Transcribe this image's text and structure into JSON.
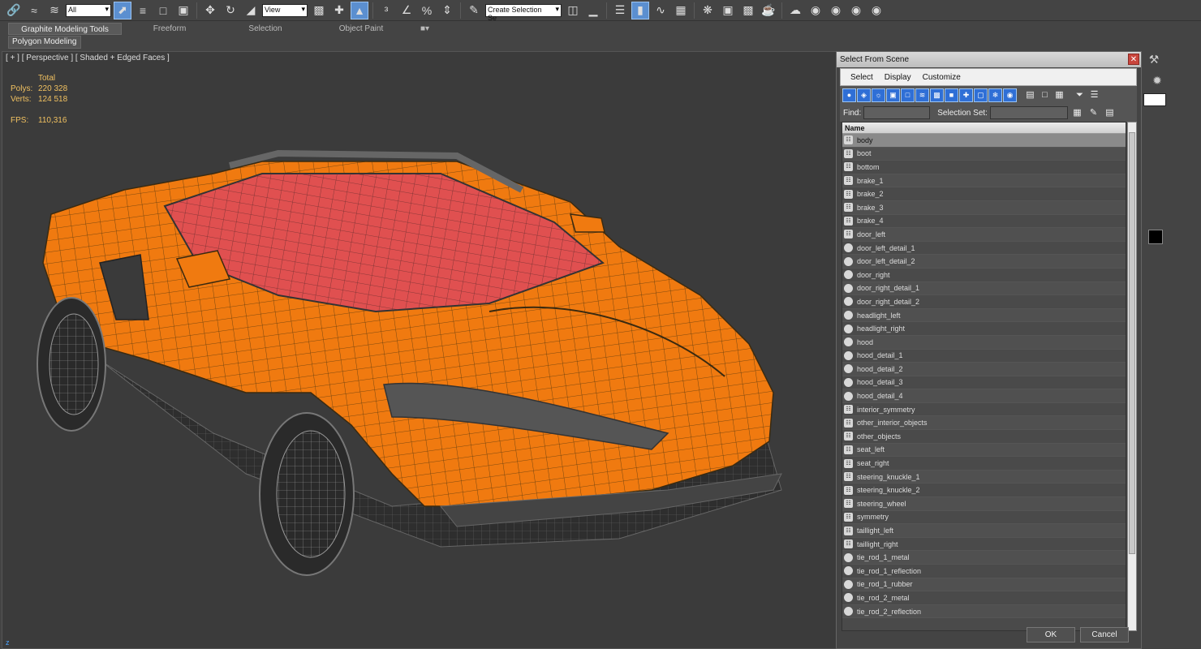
{
  "toolbar": {
    "filter_value": "All",
    "refcoord_value": "View",
    "selection_set_placeholder": "Create Selection Se",
    "icons": [
      "link-icon",
      "unlink-icon",
      "bind-space-warp-icon",
      "select-filter-dropdown",
      "select-object-icon",
      "select-by-name-icon",
      "rect-selection-icon",
      "window-crossing-icon",
      "move-icon",
      "rotate-icon",
      "scale-icon",
      "ref-coord-dropdown",
      "pivot-icon",
      "select-manipulate-icon",
      "keyboard-shortcut-icon",
      "snap-3d-icon",
      "angle-snap-icon",
      "percent-snap-icon",
      "spinner-snap-icon",
      "edit-named-sets-icon",
      "named-selection-dropdown",
      "mirror-icon",
      "align-icon",
      "layer-manager-icon",
      "graphite-toggle-icon",
      "curve-editor-icon",
      "schematic-view-icon",
      "material-editor-icon",
      "render-setup-icon",
      "rendered-frame-icon",
      "render-icon",
      "teapot-icon",
      "cloud-render-icon",
      "extra-icon-1",
      "extra-icon-2",
      "extra-icon-3"
    ]
  },
  "ribbon": {
    "tabs": [
      "Graphite Modeling Tools",
      "Freeform",
      "Selection",
      "Object Paint"
    ],
    "active_tab": "Graphite Modeling Tools",
    "sub_tab": "Polygon Modeling"
  },
  "viewport": {
    "label": "[ + ] [ Perspective ] [ Shaded + Edged Faces ]",
    "stats_header": "Total",
    "polys_label": "Polys:",
    "polys_value": "220 328",
    "verts_label": "Verts:",
    "verts_value": "124 518",
    "fps_label": "FPS:",
    "fps_value": "110,316",
    "axis_label": "z"
  },
  "dialog": {
    "title": "Select From Scene",
    "menu": [
      "Select",
      "Display",
      "Customize"
    ],
    "find_label": "Find:",
    "find_value": "",
    "selection_set_label": "Selection Set:",
    "column_header": "Name",
    "selected_item": "body",
    "items": [
      {
        "name": "body",
        "type": "group"
      },
      {
        "name": "boot",
        "type": "group"
      },
      {
        "name": "bottom",
        "type": "group"
      },
      {
        "name": "brake_1",
        "type": "group"
      },
      {
        "name": "brake_2",
        "type": "group"
      },
      {
        "name": "brake_3",
        "type": "group"
      },
      {
        "name": "brake_4",
        "type": "group"
      },
      {
        "name": "door_left",
        "type": "group"
      },
      {
        "name": "door_left_detail_1",
        "type": "object"
      },
      {
        "name": "door_left_detail_2",
        "type": "object"
      },
      {
        "name": "door_right",
        "type": "object"
      },
      {
        "name": "door_right_detail_1",
        "type": "object"
      },
      {
        "name": "door_right_detail_2",
        "type": "object"
      },
      {
        "name": "headlight_left",
        "type": "object"
      },
      {
        "name": "headlight_right",
        "type": "object"
      },
      {
        "name": "hood",
        "type": "object"
      },
      {
        "name": "hood_detail_1",
        "type": "object"
      },
      {
        "name": "hood_detail_2",
        "type": "object"
      },
      {
        "name": "hood_detail_3",
        "type": "object"
      },
      {
        "name": "hood_detail_4",
        "type": "object"
      },
      {
        "name": "interior_symmetry",
        "type": "group"
      },
      {
        "name": "other_interior_objects",
        "type": "group"
      },
      {
        "name": "other_objects",
        "type": "group"
      },
      {
        "name": "seat_left",
        "type": "group"
      },
      {
        "name": "seat_right",
        "type": "group"
      },
      {
        "name": "steering_knuckle_1",
        "type": "group"
      },
      {
        "name": "steering_knuckle_2",
        "type": "group"
      },
      {
        "name": "steering_wheel",
        "type": "group"
      },
      {
        "name": "symmetry",
        "type": "group"
      },
      {
        "name": "taillight_left",
        "type": "group"
      },
      {
        "name": "taillight_right",
        "type": "group"
      },
      {
        "name": "tie_rod_1_metal",
        "type": "object"
      },
      {
        "name": "tie_rod_1_reflection",
        "type": "object"
      },
      {
        "name": "tie_rod_1_rubber",
        "type": "object"
      },
      {
        "name": "tie_rod_2_metal",
        "type": "object"
      },
      {
        "name": "tie_rod_2_reflection",
        "type": "object"
      }
    ],
    "ok_label": "OK",
    "cancel_label": "Cancel"
  },
  "colors": {
    "car_body": "#f07a10",
    "interior": "#e05050",
    "wire": "#555555",
    "selection_blue": "#2f6fd6",
    "stats_text": "#f0c060"
  }
}
